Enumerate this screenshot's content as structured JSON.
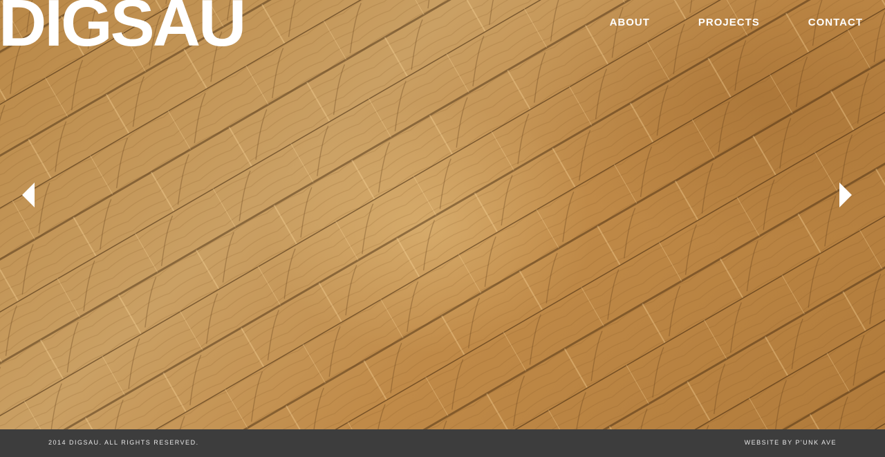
{
  "brand": {
    "logo_text": "DIGSAU"
  },
  "nav": {
    "items": [
      {
        "label": "ABOUT"
      },
      {
        "label": "PROJECTS"
      },
      {
        "label": "CONTACT"
      }
    ]
  },
  "slider": {
    "prev_icon": "chevron-left-icon",
    "next_icon": "chevron-right-icon"
  },
  "footer": {
    "copyright": "2014 DIGSAU. ALL RIGHTS RESERVED.",
    "credit": "WEBSITE BY P'UNK AVE"
  },
  "colors": {
    "wood": "#c3924f",
    "footer_bg": "#3d3d3d",
    "text": "#ffffff"
  }
}
